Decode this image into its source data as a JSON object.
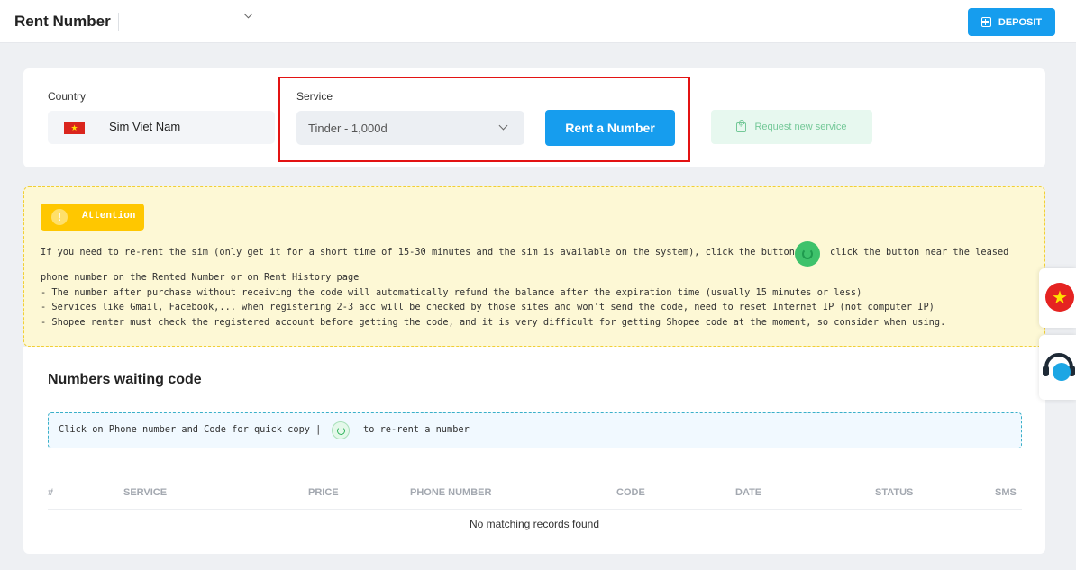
{
  "header": {
    "title": "Rent Number",
    "deposit_label": "DEPOSIT"
  },
  "selection": {
    "country_label": "Country",
    "country_value": "Sim Viet Nam",
    "service_label": "Service",
    "service_value": "Tinder - 1,000d",
    "rent_button": "Rent a Number",
    "request_button": "Request new service"
  },
  "attention": {
    "badge_icon": "!",
    "badge": "Attention",
    "line1_before": "If you need to re-rent the sim (only get it for a short time of 15-30 minutes and the sim is available on the system), click the button",
    "line1_after": "click the button near the leased",
    "line2": "phone number on the Rented Number or on Rent History page",
    "line3": "- The number after purchase without receiving the code will automatically refund the balance after the expiration time (usually 15 minutes or less)",
    "line4": "- Services like Gmail, Facebook,... when registering 2-3 acc will be checked by those sites and won't send the code, need to reset Internet IP (not computer IP)",
    "line5": "- Shopee renter must check the registered account before getting the code, and it is very difficult for getting Shopee code at the moment, so consider when using."
  },
  "waiting": {
    "title": "Numbers waiting code",
    "info_before": "Click on Phone number and Code for quick copy |",
    "info_after": "to re-rent a number",
    "columns": [
      "#",
      "SERVICE",
      "PRICE",
      "PHONE NUMBER",
      "CODE",
      "DATE",
      "STATUS",
      "SMS"
    ],
    "empty_message": "No matching records found"
  },
  "colors": {
    "primary": "#169dee",
    "attention_bg": "#fdf8d5",
    "highlight": "#e31313",
    "success": "#3ec26b"
  },
  "icons": [
    "plus-square-icon",
    "vietnam-flag-icon",
    "chevron-down-icon",
    "shopping-bag-icon",
    "warning-icon",
    "rerent-icon",
    "language-flag-icon",
    "support-headset-icon"
  ]
}
